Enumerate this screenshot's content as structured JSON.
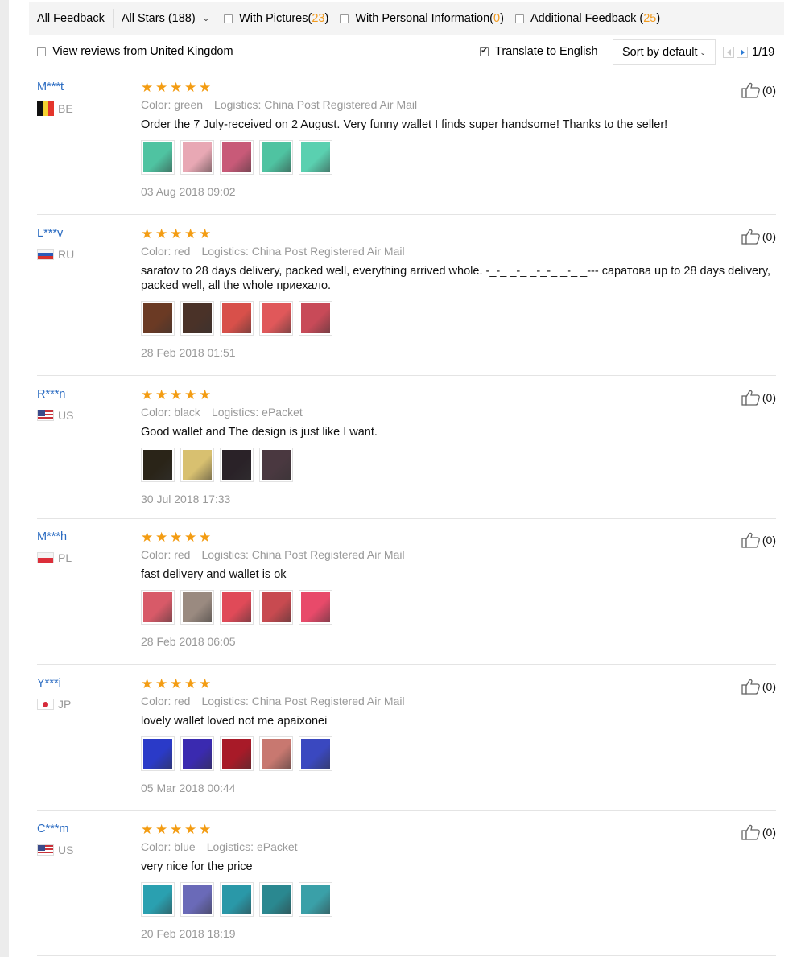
{
  "filters": {
    "all_feedback": "All Feedback",
    "all_stars": "All Stars (188)",
    "with_pictures_label": "With Pictures",
    "with_pictures_count": "23",
    "personal_info_label": "With Personal Information",
    "personal_info_count": "0",
    "additional_label": "Additional Feedback",
    "additional_count": "25"
  },
  "options": {
    "view_uk": "View reviews from United Kingdom",
    "view_uk_checked": false,
    "translate": "Translate to English",
    "translate_checked": true,
    "sort": "Sort by default",
    "page": "1/19"
  },
  "colors": {
    "accent_link": "#2b6cc2",
    "star": "#f39c12",
    "count": "#f29b1f"
  },
  "reviews": [
    {
      "user": "M***t",
      "country": "BE",
      "flag": "flag-be",
      "stars": 5,
      "color_label": "Color: green",
      "logistics": "Logistics: China Post Registered Air Mail",
      "text": "Order the 7 July-received on 2 August. Very funny wallet I finds super handsome! Thanks to the seller!",
      "thumbs": [
        "#4fc3a1",
        "#e8a8b4",
        "#c85a78",
        "#4fc3a1",
        "#5ad0b0"
      ],
      "date": "03 Aug 2018 09:02",
      "likes": "(0)"
    },
    {
      "user": "L***v",
      "country": "RU",
      "flag": "flag-ru",
      "stars": 5,
      "color_label": "Color: red",
      "logistics": "Logistics: China Post Registered Air Mail",
      "text": "saratov to 28 days delivery, packed well, everything arrived whole. -_-_ _-_ _-_-_ _-_ _--- саратова up to 28 days delivery, packed well, all the whole приехало.",
      "thumbs": [
        "#6b3a24",
        "#4a3228",
        "#d8504a",
        "#e0585a",
        "#c84a58"
      ],
      "date": "28 Feb 2018 01:51",
      "likes": "(0)"
    },
    {
      "user": "R***n",
      "country": "US",
      "flag": "flag-us",
      "stars": 5,
      "color_label": "Color: black",
      "logistics": "Logistics: ePacket",
      "text": "Good wallet and The design is just like I want.",
      "thumbs": [
        "#2a2418",
        "#d8c070",
        "#2a2228",
        "#4a3840"
      ],
      "date": "30 Jul 2018 17:33",
      "likes": "(0)"
    },
    {
      "user": "M***h",
      "country": "PL",
      "flag": "flag-pl",
      "stars": 5,
      "color_label": "Color: red",
      "logistics": "Logistics: China Post Registered Air Mail",
      "text": "fast delivery and wallet is ok",
      "thumbs": [
        "#d85a68",
        "#9a8a80",
        "#e04a58",
        "#c84a50",
        "#e84a6a"
      ],
      "date": "28 Feb 2018 06:05",
      "likes": "(0)"
    },
    {
      "user": "Y***i",
      "country": "JP",
      "flag": "flag-jp",
      "stars": 5,
      "color_label": "Color: red",
      "logistics": "Logistics: China Post Registered Air Mail",
      "text": "lovely wallet loved not me apaixonei",
      "thumbs": [
        "#2a3ac8",
        "#3a2ab0",
        "#a81a28",
        "#c87870",
        "#3a48c0"
      ],
      "date": "05 Mar 2018 00:44",
      "likes": "(0)"
    },
    {
      "user": "C***m",
      "country": "US",
      "flag": "flag-us",
      "stars": 5,
      "color_label": "Color: blue",
      "logistics": "Logistics: ePacket",
      "text": "very nice for the price",
      "thumbs": [
        "#2aa0b0",
        "#6a6ab8",
        "#2a98a8",
        "#2a8890",
        "#3aa0a8"
      ],
      "date": "20 Feb 2018 18:19",
      "likes": "(0)"
    }
  ]
}
